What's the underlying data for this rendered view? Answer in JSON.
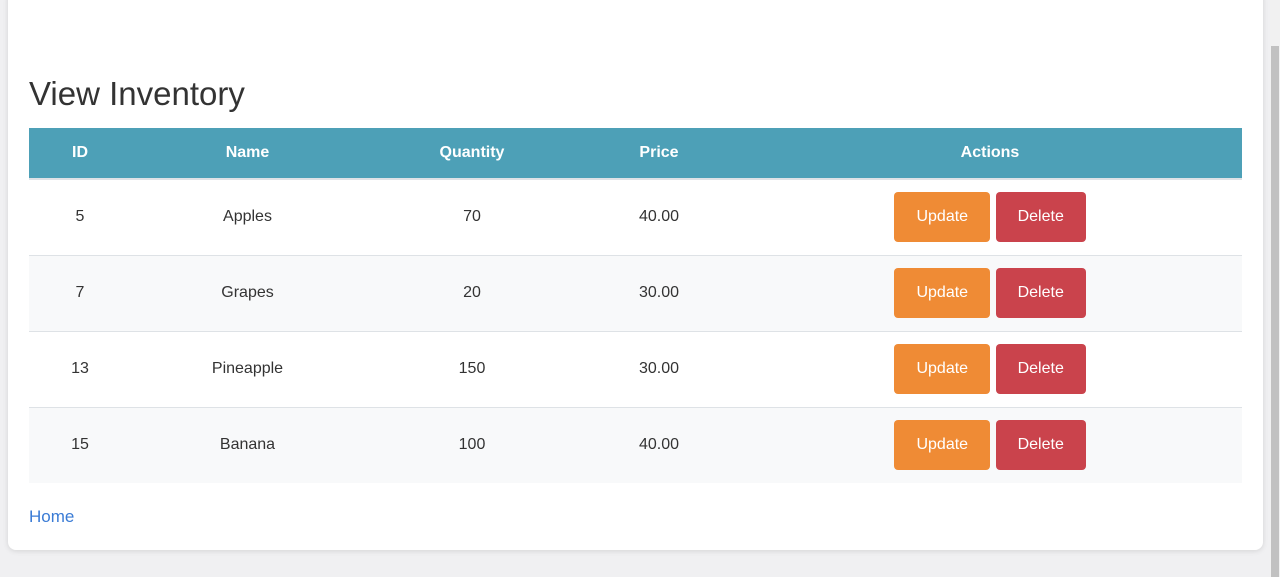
{
  "page": {
    "title": "View Inventory",
    "home_link": "Home"
  },
  "table": {
    "headers": {
      "id": "ID",
      "name": "Name",
      "quantity": "Quantity",
      "price": "Price",
      "actions": "Actions"
    },
    "rows": [
      {
        "id": "5",
        "name": "Apples",
        "quantity": "70",
        "price": "40.00"
      },
      {
        "id": "7",
        "name": "Grapes",
        "quantity": "20",
        "price": "30.00"
      },
      {
        "id": "13",
        "name": "Pineapple",
        "quantity": "150",
        "price": "30.00"
      },
      {
        "id": "15",
        "name": "Banana",
        "quantity": "100",
        "price": "40.00"
      }
    ],
    "update_label": "Update",
    "delete_label": "Delete"
  },
  "colors": {
    "header_bg": "#4da0b7",
    "update_button": "#ef8b35",
    "delete_button": "#ca434c",
    "link": "#3a7bd5"
  }
}
